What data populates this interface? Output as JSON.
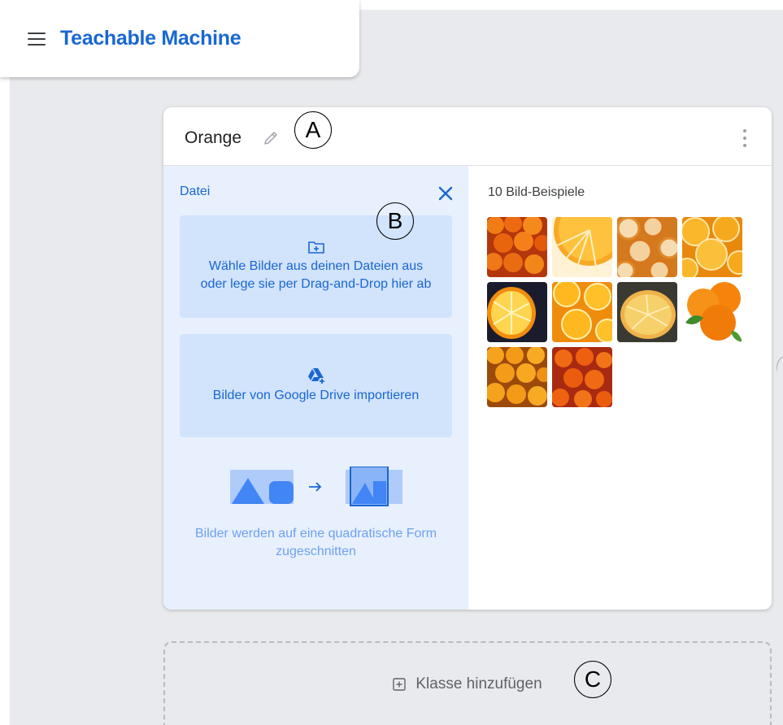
{
  "app": {
    "title": "Teachable Machine"
  },
  "class_card": {
    "name": "Orange",
    "upload": {
      "title": "Datei",
      "files_label": "Wähle Bilder aus deinen Dateien aus oder lege sie per Drag-and-Drop hier ab",
      "drive_label": "Bilder von Google Drive importieren",
      "crop_note": "Bilder werden auf eine quadratische Form zugeschnitten"
    },
    "samples": {
      "title": "10 Bild-Beispiele",
      "count": 10
    }
  },
  "add_class": {
    "label": "Klasse hinzufügen"
  },
  "annotations": [
    "A",
    "B",
    "C"
  ],
  "icons": [
    "menu-icon",
    "pencil-icon",
    "more-vert-icon",
    "close-icon",
    "folder-add-icon",
    "google-drive-icon",
    "arrow-right-icon",
    "add-box-icon"
  ],
  "colors": {
    "accent": "#1967d2",
    "panel_bg": "#e8f0fe",
    "box_bg": "#d2e3fc",
    "canvas_bg": "#e8eaed"
  }
}
